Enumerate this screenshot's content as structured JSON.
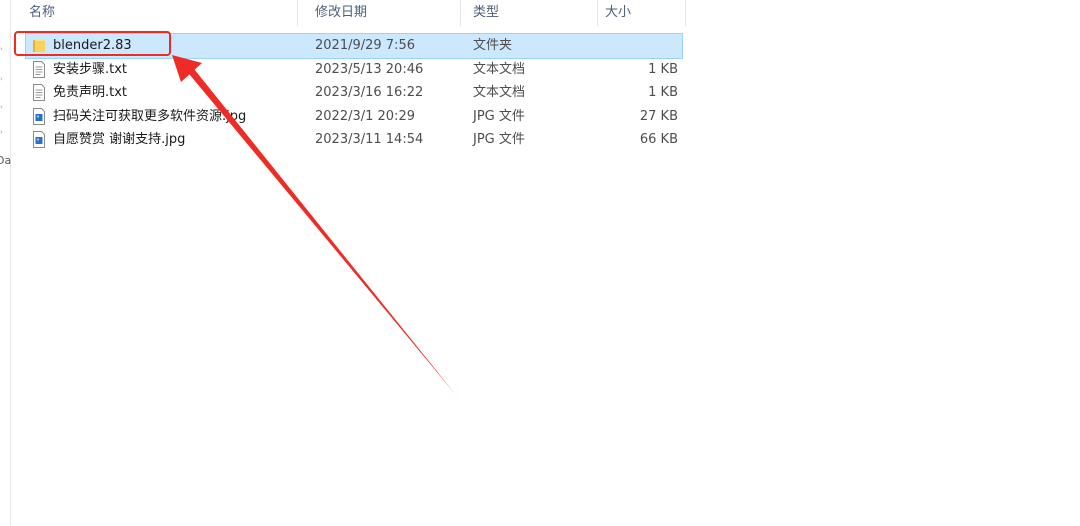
{
  "header": {
    "columns": [
      {
        "key": "name",
        "label": "名称"
      },
      {
        "key": "date",
        "label": "修改日期"
      },
      {
        "key": "type",
        "label": "类型"
      },
      {
        "key": "size",
        "label": "大小"
      }
    ],
    "sort_indicator": "^"
  },
  "nav": {
    "cut_text": "Da"
  },
  "files": [
    {
      "name": "blender2.83",
      "date": "2021/9/29 7:56",
      "type": "文件夹",
      "size": "",
      "icon": "folder-icon",
      "selected": true
    },
    {
      "name": "安装步骤.txt",
      "date": "2023/5/13 20:46",
      "type": "文本文档",
      "size": "1 KB",
      "icon": "text-file-icon",
      "selected": false
    },
    {
      "name": "免责声明.txt",
      "date": "2023/3/16 16:22",
      "type": "文本文档",
      "size": "1 KB",
      "icon": "text-file-icon",
      "selected": false
    },
    {
      "name": "扫码关注可获取更多软件资源.jpg",
      "date": "2022/3/1 20:29",
      "type": "JPG 文件",
      "size": "27 KB",
      "icon": "image-file-icon",
      "selected": false
    },
    {
      "name": "自愿赞赏 谢谢支持.jpg",
      "date": "2023/3/11 14:54",
      "type": "JPG 文件",
      "size": "66 KB",
      "icon": "image-file-icon",
      "selected": false
    }
  ],
  "colors": {
    "selection_bg": "#cce8ff",
    "selection_border": "#99d1ff",
    "annotation_red": "#ee2b24",
    "header_text": "#4c607a",
    "folder_yellow": "#f4c542"
  }
}
